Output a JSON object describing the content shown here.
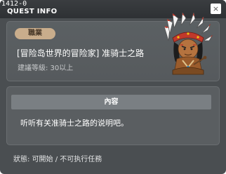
{
  "window": {
    "id_label": "1412-0",
    "title": "QUEST INFO",
    "close_symbol": "×"
  },
  "quest": {
    "job_badge": "職業",
    "name": "[冒险岛世界的冒险家] 准骑士之路",
    "level_requirement": "建議等級: 30以上",
    "npc_portrait_icon": "native-chief-npc-icon"
  },
  "content": {
    "header": "內容",
    "text": "听听有关准骑士之路的说明吧。"
  },
  "status": {
    "text": "狀態: 可開始 / 不可执行任務"
  },
  "colors": {
    "window_bg": "#4a4e51",
    "titlebar_bg": "#2e3134",
    "panel_bg": "#5a5e61",
    "badge_bg": "#c9ad8c",
    "header_bg": "#7a7f83"
  }
}
